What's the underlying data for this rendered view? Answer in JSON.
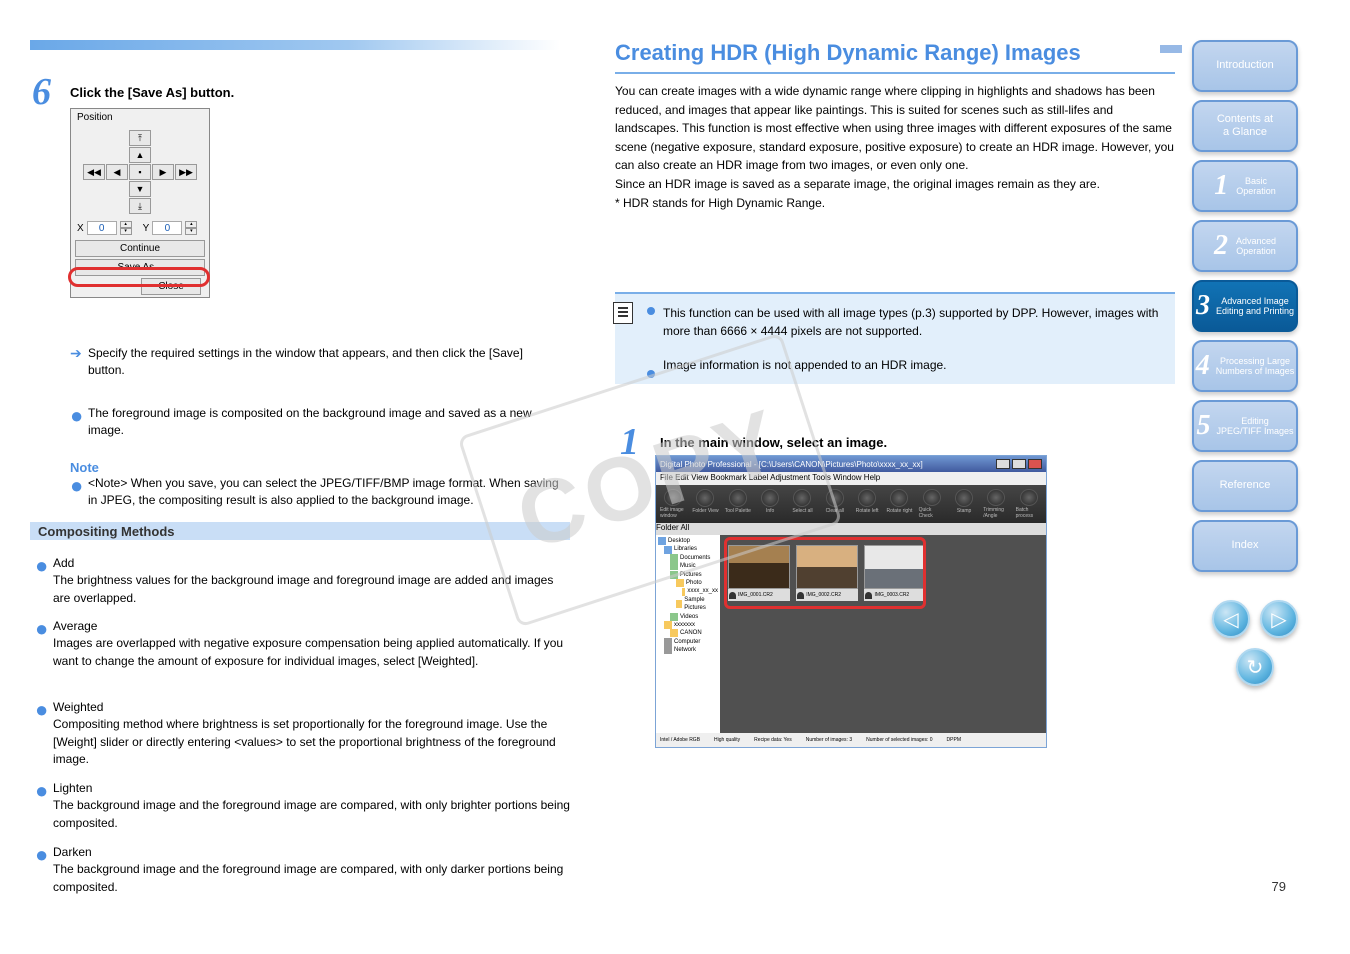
{
  "topbar": {},
  "left": {
    "step_num": "6",
    "step_text": "Click the [Save As] button.",
    "panel": {
      "title": "Position",
      "x_label": "X",
      "y_label": "Y",
      "x_value": "0",
      "y_value": "0",
      "continue": "Continue",
      "saveas": "Save As...",
      "close": "Close"
    },
    "arrow_text": "Specify the required settings in the window that appears, and then click the [Save] button.",
    "bullets": [
      "The foreground image is composited on the background image and saved as a new image.",
      "<Note> When you save, you can select the JPEG/TIFF/BMP image format. When saving in JPEG, the compositing result is also applied to the background image."
    ],
    "section_title": "Compositing Methods",
    "methods": [
      {
        "name": "Add",
        "desc": "The brightness values for the background image and foreground image are added and images are overlapped."
      },
      {
        "name": "Average",
        "desc": "Images are overlapped with negative exposure compensation being applied automatically. If you want to change the amount of exposure for individual images, select [Weighted]."
      },
      {
        "name": "Weighted",
        "desc": "Compositing method where brightness is set proportionally for the foreground image. Use the [Weight] slider or directly entering <values> to set the proportional brightness of the foreground image."
      },
      {
        "name": "Lighten",
        "desc": "The background image and the foreground image are compared, with only brighter portions being composited."
      },
      {
        "name": "Darken",
        "desc": "The background image and the foreground image are compared, with only darker portions being composited."
      }
    ]
  },
  "right": {
    "heading": "Creating HDR (High Dynamic Range) Images",
    "intro": "You can create images with a wide dynamic range where clipping in highlights and shadows has been reduced, and images that appear like paintings. This is suited for scenes such as still-lifes and landscapes. This function is most effective when using three images with different exposures of the same scene (negative exposure, standard exposure, positive exposure) to create an HDR image. However, you can also create an HDR image from two images, or even only one.\nSince an HDR image is saved as a separate image, the original images remain as they are.\n* HDR stands for High Dynamic Range.",
    "info1": "This function can be used with all image types (p.3) supported by DPP. However, images with more than 6666 × 4444 pixels are not supported.",
    "info2": "Image information is not appended to an HDR image.",
    "step_num": "1",
    "step_text": "In the main window, select an image.",
    "shot": {
      "title": "Digital Photo Professional - [C:\\Users\\CANON\\Pictures\\Photo\\xxxx_xx_xx]",
      "menu": "File   Edit   View   Bookmark   Label   Adjustment   Tools   Window   Help",
      "tools": [
        "Edit image window",
        "Folder View",
        "Tool Palette",
        "Info",
        "Select all",
        "Clear all",
        "Rotate left",
        "Rotate right",
        "Quick Check",
        "Stamp",
        "Trimming /Angle",
        "Batch process"
      ],
      "subbar": "Folder          All",
      "tree": [
        "Desktop",
        "Libraries",
        "Documents",
        "Music",
        "Pictures",
        "Photo",
        "xxxx_xx_xx",
        "Sample Pictures",
        "Videos",
        "xxxxxxx",
        "CANON",
        "Computer",
        "Network"
      ],
      "thumbs": [
        "IMG_0001.CR2",
        "IMG_0002.CR2",
        "IMG_0003.CR2"
      ],
      "status": [
        "Intel / Adobe RGB",
        "High quality",
        "Recipe data: Yes",
        "Number of images: 3",
        "Number of selected images: 0",
        "DPPM"
      ]
    }
  },
  "tabs": [
    {
      "num": "",
      "txt": "Introduction"
    },
    {
      "num": "",
      "txt": "Contents at\na Glance"
    },
    {
      "num": "1",
      "txt": "Basic\nOperation"
    },
    {
      "num": "2",
      "txt": "Advanced\nOperation"
    },
    {
      "num": "3",
      "txt": "Advanced Image\nEditing and Printing",
      "active": true
    },
    {
      "num": "4",
      "txt": "Processing Large\nNumbers of Images"
    },
    {
      "num": "5",
      "txt": "Editing\nJPEG/TIFF Images"
    },
    {
      "num": "",
      "txt": "Reference"
    },
    {
      "num": "",
      "txt": "Index"
    }
  ],
  "watermark": "COPY",
  "page": "79"
}
